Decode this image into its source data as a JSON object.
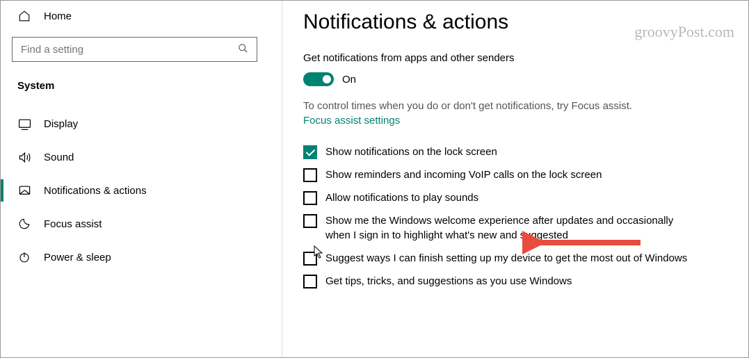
{
  "sidebar": {
    "home_label": "Home",
    "search_placeholder": "Find a setting",
    "category": "System",
    "items": [
      {
        "label": "Display"
      },
      {
        "label": "Sound"
      },
      {
        "label": "Notifications & actions"
      },
      {
        "label": "Focus assist"
      },
      {
        "label": "Power & sleep"
      }
    ]
  },
  "main": {
    "title": "Notifications & actions",
    "notifications_label": "Get notifications from apps and other senders",
    "toggle_state": "On",
    "focus_desc": "To control times when you do or don't get notifications, try Focus assist.",
    "focus_link": "Focus assist settings",
    "checkboxes": [
      {
        "checked": true,
        "label": "Show notifications on the lock screen"
      },
      {
        "checked": false,
        "label": "Show reminders and incoming VoIP calls on the lock screen"
      },
      {
        "checked": false,
        "label": "Allow notifications to play sounds"
      },
      {
        "checked": false,
        "label": "Show me the Windows welcome experience after updates and occasionally when I sign in to highlight what's new and suggested"
      },
      {
        "checked": false,
        "label": "Suggest ways I can finish setting up my device to get the most out of Windows"
      },
      {
        "checked": false,
        "label": "Get tips, tricks, and suggestions as you use Windows"
      }
    ]
  },
  "watermark": "groovyPost.com"
}
